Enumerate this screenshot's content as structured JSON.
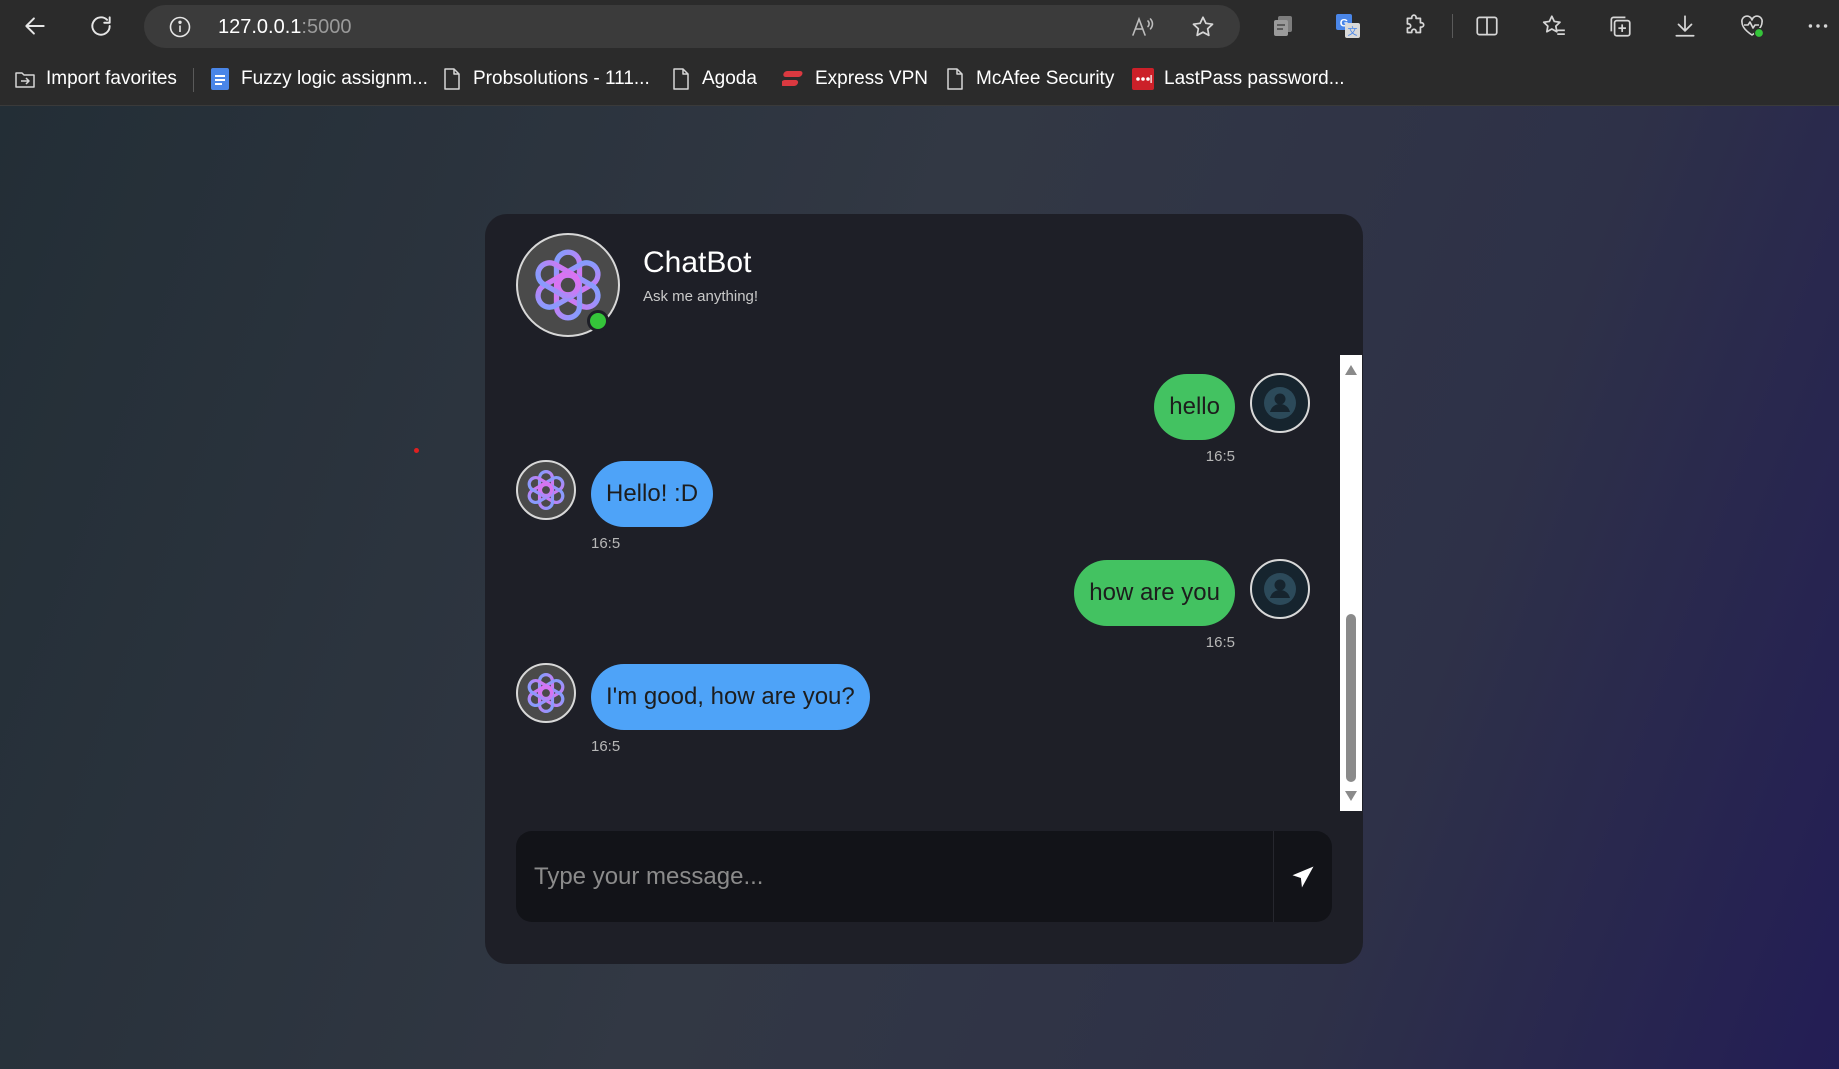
{
  "browser": {
    "url_host": "127.0.0.1",
    "url_port": ":5000",
    "icons": {
      "back": "back-arrow-icon",
      "reload": "reload-icon",
      "site_info": "info-icon",
      "read_aloud": "read-aloud-icon",
      "favorite": "star-icon",
      "extensions": "puzzle-icon",
      "split_screen": "split-screen-icon",
      "favorites": "favorites-icon",
      "collections": "collections-icon",
      "downloads": "download-icon",
      "health": "browser-essentials-icon",
      "more": "more-icon"
    }
  },
  "bookmarks": [
    {
      "label": "Import favorites",
      "icon": "import-icon"
    },
    {
      "label": "Fuzzy logic assignm...",
      "icon": "google-docs-icon"
    },
    {
      "label": "Probsolutions - 111...",
      "icon": "page-icon"
    },
    {
      "label": "Agoda",
      "icon": "page-icon"
    },
    {
      "label": "Express VPN",
      "icon": "expressvpn-icon"
    },
    {
      "label": "McAfee Security",
      "icon": "page-icon"
    },
    {
      "label": "LastPass password...",
      "icon": "lastpass-icon"
    }
  ],
  "chat": {
    "title": "ChatBot",
    "subtitle": "Ask me anything!",
    "status": "online",
    "messages": [
      {
        "sender": "user",
        "text": "hello",
        "time": "16:5"
      },
      {
        "sender": "bot",
        "text": "Hello! :D",
        "time": "16:5"
      },
      {
        "sender": "user",
        "text": "how are you",
        "time": "16:5"
      },
      {
        "sender": "bot",
        "text": "I'm good, how are you?",
        "time": "16:5"
      }
    ],
    "input_placeholder": "Type your message...",
    "input_value": "",
    "colors": {
      "user_bubble": "#43c261",
      "bot_bubble": "#4ea3f8",
      "online": "#35c43a",
      "card": "#1e1f27"
    }
  }
}
